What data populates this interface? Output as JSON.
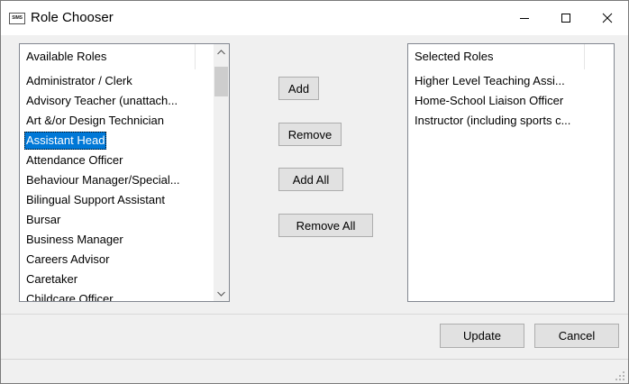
{
  "window": {
    "title": "Role Chooser",
    "app_icon_text": "SIMS"
  },
  "available": {
    "header": "Available Roles",
    "items": [
      "Administrator / Clerk",
      "Advisory Teacher (unattach...",
      "Art &/or Design Technician",
      "Assistant Head",
      "Attendance Officer",
      "Behaviour Manager/Special...",
      "Bilingual Support Assistant",
      "Bursar",
      "Business Manager",
      "Careers Advisor",
      "Caretaker",
      "Childcare Officer"
    ],
    "selected_index": 3
  },
  "selected": {
    "header": "Selected Roles",
    "items": [
      "Higher Level Teaching Assi...",
      "Home-School Liaison Officer",
      "Instructor (including sports c..."
    ]
  },
  "buttons": {
    "add": "Add",
    "remove": "Remove",
    "add_all": "Add All",
    "remove_all": "Remove All",
    "update": "Update",
    "cancel": "Cancel"
  }
}
